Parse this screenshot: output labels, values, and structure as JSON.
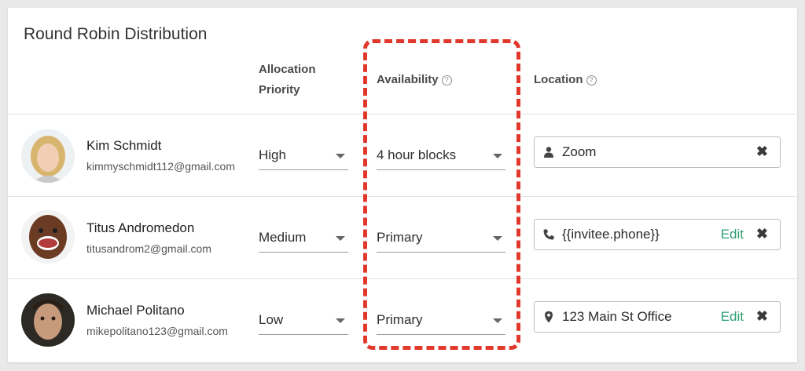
{
  "card": {
    "title": "Round Robin Distribution"
  },
  "columns": {
    "allocation_line1": "Allocation",
    "allocation_line2": "Priority",
    "availability": "Availability",
    "location": "Location",
    "help_glyph": "?"
  },
  "rows": [
    {
      "name": "Kim Schmidt",
      "email": "kimmyschmidt112@gmail.com",
      "priority": "High",
      "availability": "4 hour blocks",
      "location": {
        "icon": "person-icon",
        "text": "Zoom",
        "edit": "",
        "remove": "✖"
      }
    },
    {
      "name": "Titus Andromedon",
      "email": "titusandrom2@gmail.com",
      "priority": "Medium",
      "availability": "Primary",
      "location": {
        "icon": "phone-icon",
        "text": "{{invitee.phone}}",
        "edit": "Edit",
        "remove": "✖"
      }
    },
    {
      "name": "Michael Politano",
      "email": "mikepolitano123@gmail.com",
      "priority": "Low",
      "availability": "Primary",
      "location": {
        "icon": "map-pin-icon",
        "text": "123 Main St Office",
        "edit": "Edit",
        "remove": "✖"
      }
    }
  ],
  "colors": {
    "accent": "#2e9e73",
    "highlight": "#e1382b"
  }
}
